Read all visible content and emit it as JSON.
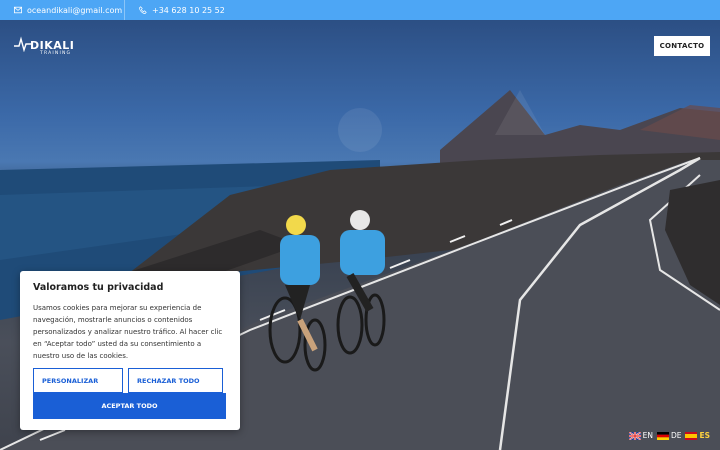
{
  "topbar": {
    "email": "oceandikali@gmail.com",
    "phone": "+34 628 10 25 52",
    "email_icon": "envelope-icon",
    "phone_icon": "phone-icon"
  },
  "header": {
    "logo_text": "DIKALI",
    "logo_sub": "TRAINING",
    "contact_label": "CONTACTO"
  },
  "cookie": {
    "title": "Valoramos tu privacidad",
    "body": "Usamos cookies para mejorar su experiencia de navegación, mostrarle anuncios o contenidos personalizados y analizar nuestro tráfico. Al hacer clic en “Aceptar todo” usted da su consentimiento a nuestro uso de las cookies.",
    "customize_label": "PERSONALIZAR",
    "reject_label": "RECHAZAR TODO",
    "accept_label": "ACEPTAR TODO"
  },
  "languages": [
    {
      "code": "EN",
      "active": false
    },
    {
      "code": "DE",
      "active": false
    },
    {
      "code": "ES",
      "active": true
    }
  ],
  "colors": {
    "topbar": "#4da6f5",
    "accent": "#1a5fd6",
    "active_lang": "#ffd23f"
  }
}
